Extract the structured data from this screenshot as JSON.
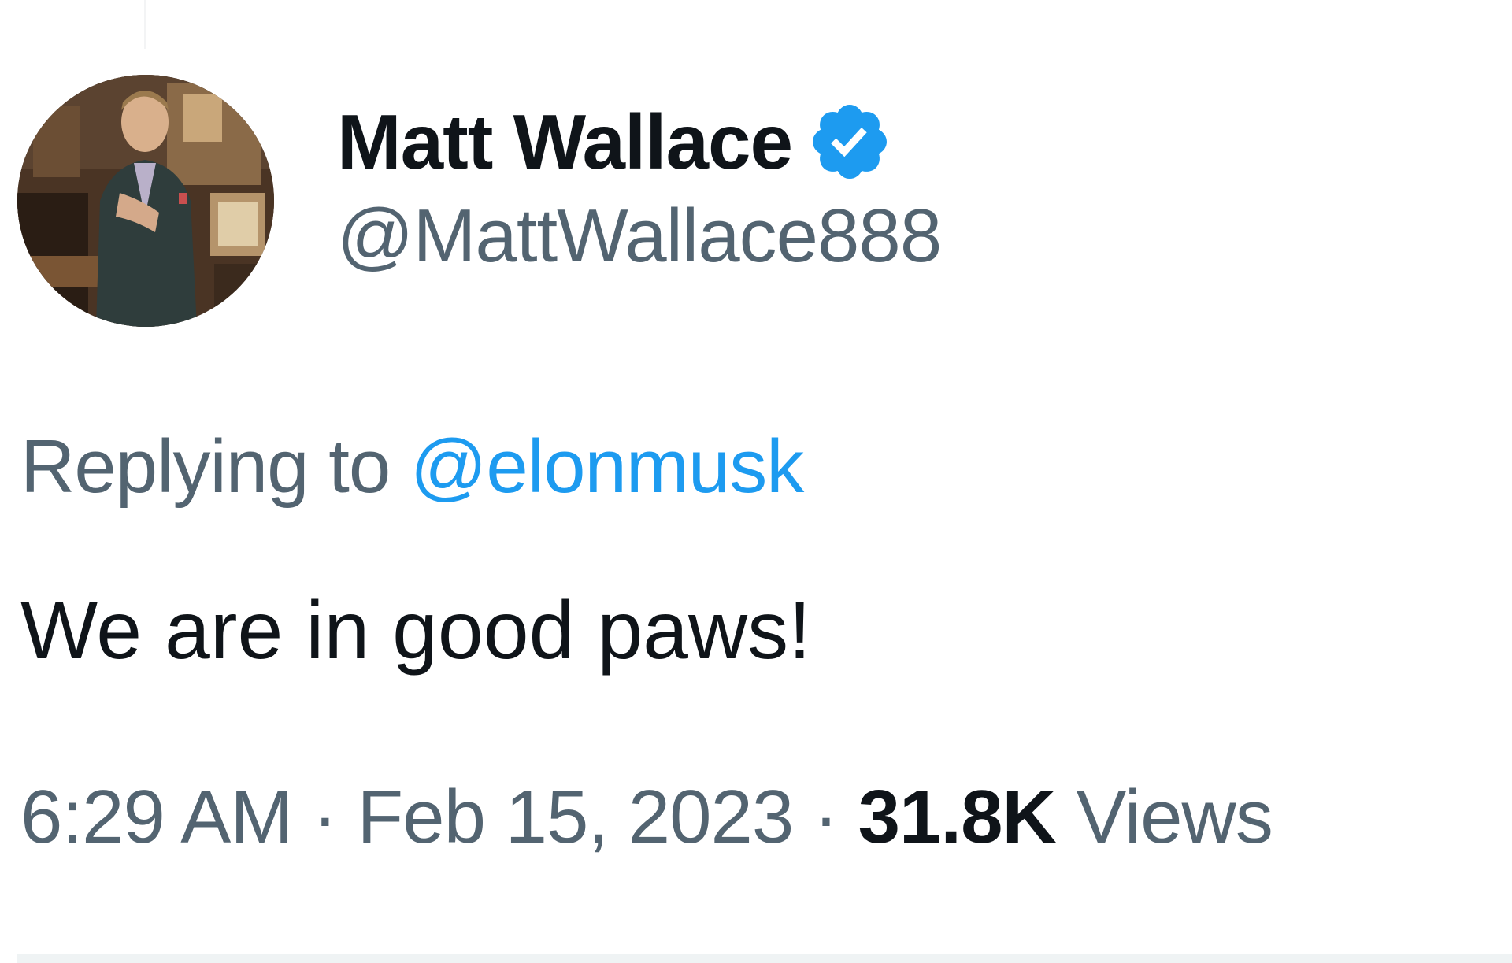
{
  "tweet": {
    "author": {
      "display_name": "Matt Wallace",
      "handle": "@MattWallace888",
      "verified": true,
      "verified_icon": "verified-badge-icon",
      "avatar_icon": "profile-photo"
    },
    "replying_to": {
      "prefix": "Replying to",
      "mention": "@elonmusk"
    },
    "text": "We are in good paws!",
    "meta": {
      "time": "6:29 AM",
      "separator": "·",
      "date": "Feb 15, 2023",
      "views_count": "31.8K",
      "views_label": "Views"
    }
  },
  "colors": {
    "text_primary": "#0f1419",
    "text_secondary": "#536471",
    "accent": "#1d9bf0"
  }
}
